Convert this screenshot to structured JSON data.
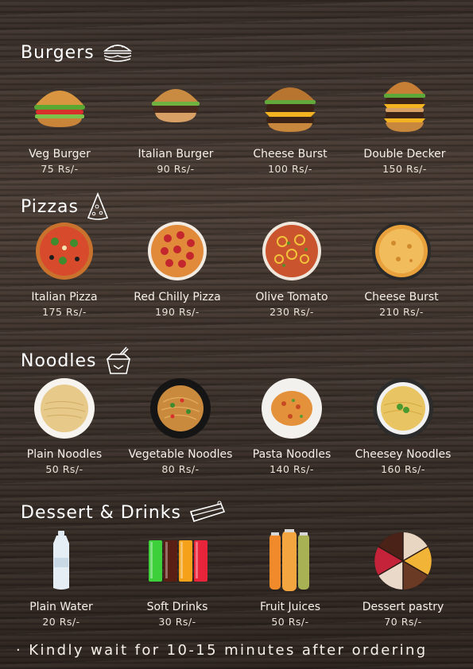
{
  "sections": [
    {
      "title": "Burgers",
      "icon": "burger-icon",
      "items": [
        {
          "name": "Veg Burger",
          "price": "75 Rs/-",
          "icon": "veg-burger-image"
        },
        {
          "name": "Italian Burger",
          "price": "90 Rs/-",
          "icon": "italian-burger-image"
        },
        {
          "name": "Cheese Burst",
          "price": "100 Rs/-",
          "icon": "cheese-burst-burger-image"
        },
        {
          "name": "Double Decker",
          "price": "150 Rs/-",
          "icon": "double-decker-burger-image"
        }
      ]
    },
    {
      "title": "Pizzas",
      "icon": "pizza-slice-icon",
      "items": [
        {
          "name": "Italian Pizza",
          "price": "175 Rs/-",
          "icon": "italian-pizza-image"
        },
        {
          "name": "Red Chilly Pizza",
          "price": "190 Rs/-",
          "icon": "red-chilly-pizza-image"
        },
        {
          "name": "Olive Tomato",
          "price": "230 Rs/-",
          "icon": "olive-tomato-pizza-image"
        },
        {
          "name": "Cheese Burst",
          "price": "210 Rs/-",
          "icon": "cheese-burst-pizza-image"
        }
      ]
    },
    {
      "title": "Noodles",
      "icon": "noodle-box-icon",
      "items": [
        {
          "name": "Plain Noodles",
          "price": "50 Rs/-",
          "icon": "plain-noodles-image"
        },
        {
          "name": "Vegetable Noodles",
          "price": "80 Rs/-",
          "icon": "vegetable-noodles-image"
        },
        {
          "name": "Pasta Noodles",
          "price": "140 Rs/-",
          "icon": "pasta-noodles-image"
        },
        {
          "name": "Cheesey Noodles",
          "price": "160 Rs/-",
          "icon": "cheesey-noodles-image"
        }
      ]
    },
    {
      "title": "Dessert & Drinks",
      "icon": "cake-slice-icon",
      "items": [
        {
          "name": "Plain Water",
          "price": "20 Rs/-",
          "icon": "water-bottle-image"
        },
        {
          "name": "Soft Drinks",
          "price": "30 Rs/-",
          "icon": "soft-drinks-image"
        },
        {
          "name": "Fruit Juices",
          "price": "50 Rs/-",
          "icon": "fruit-juices-image"
        },
        {
          "name": "Dessert pastry",
          "price": "70 Rs/-",
          "icon": "dessert-pastry-image"
        }
      ]
    }
  ],
  "footer_note": "· Kindly wait for 10-15 minutes after ordering",
  "colors": {
    "background": "#3f342d",
    "text": "#f5f0e8"
  }
}
